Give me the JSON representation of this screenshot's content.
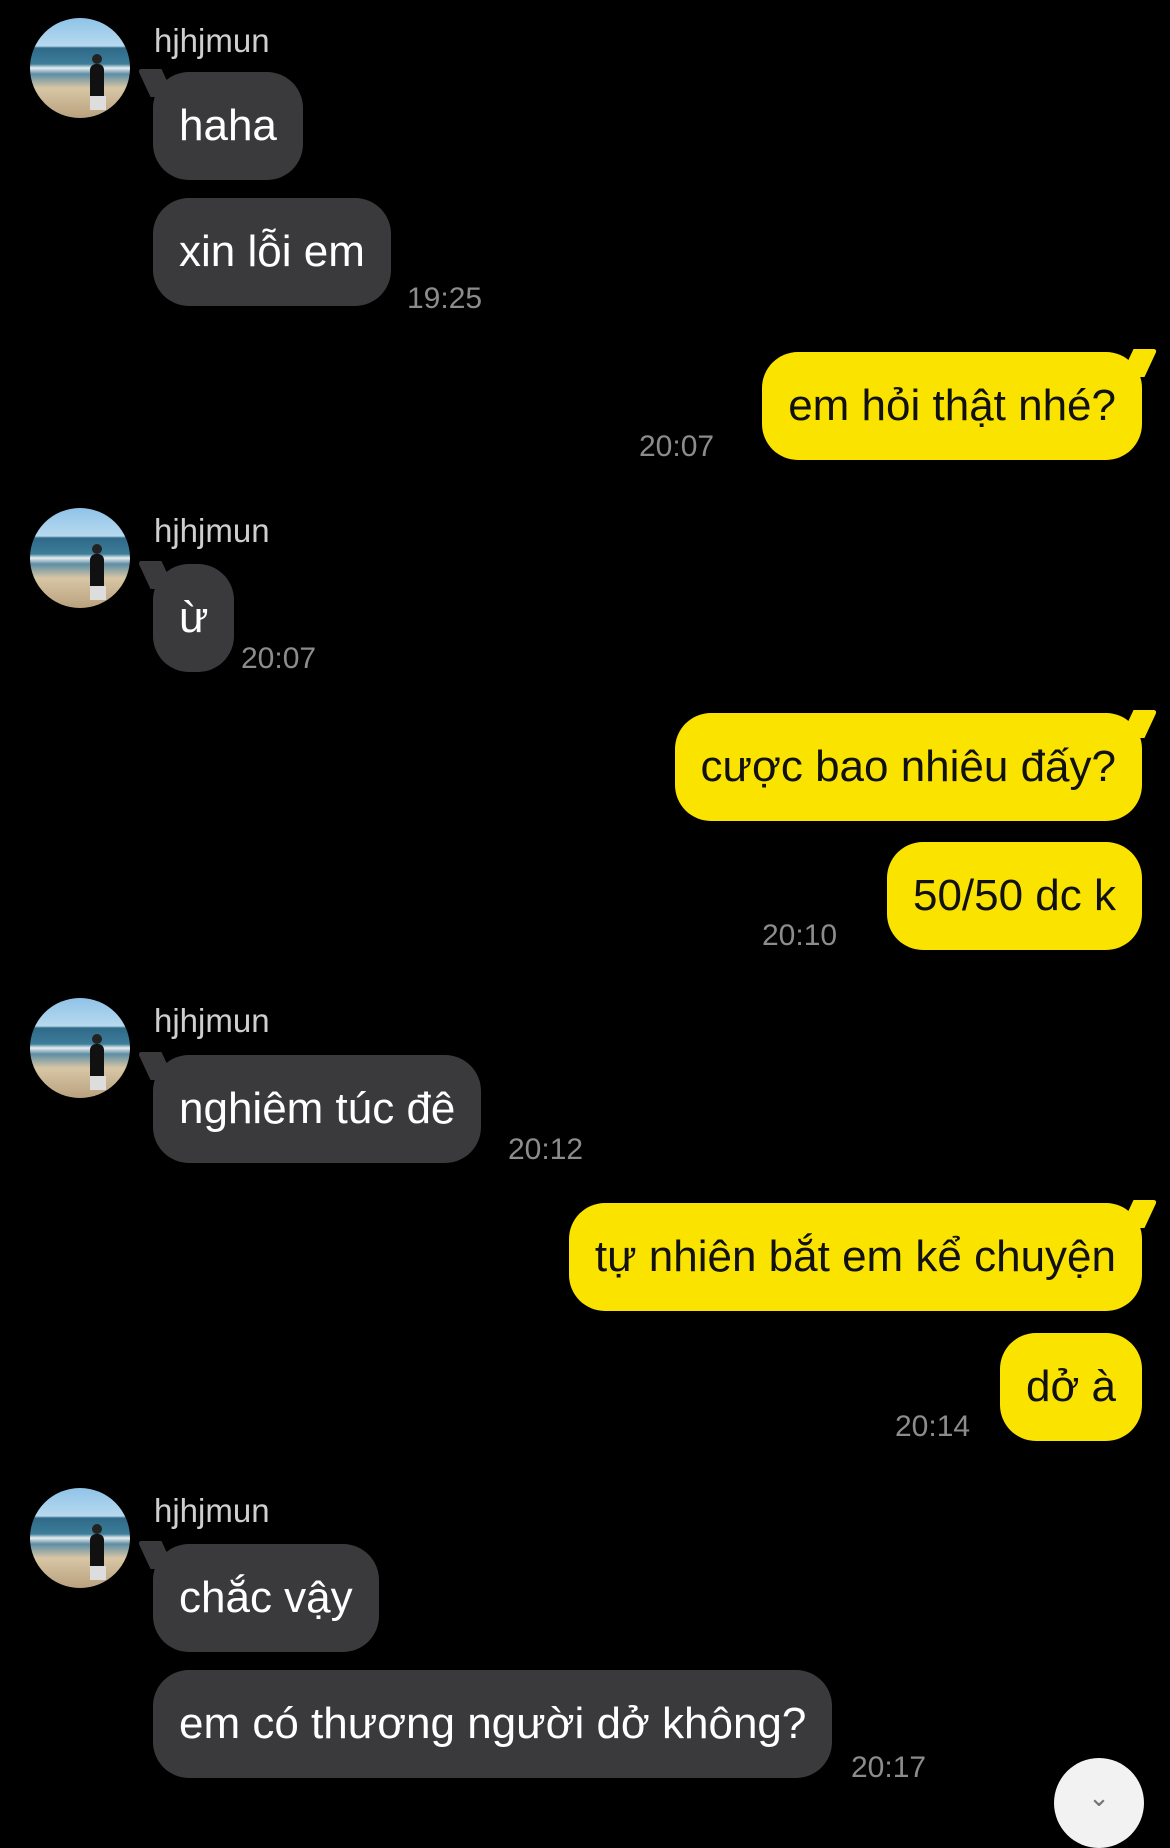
{
  "chat": {
    "messages": [
      {
        "sender": "hjhjmun",
        "text": "haha",
        "time": ""
      },
      {
        "sender": "hjhjmun",
        "text": "xin lỗi em",
        "time": "19:25"
      },
      {
        "sender": "me",
        "text": "em hỏi thật nhé?",
        "time": "20:07"
      },
      {
        "sender": "hjhjmun",
        "text": "ừ",
        "time": "20:07"
      },
      {
        "sender": "me",
        "text": "cược bao nhiêu đấy?",
        "time": ""
      },
      {
        "sender": "me",
        "text": "50/50 dc k",
        "time": "20:10"
      },
      {
        "sender": "hjhjmun",
        "text": "nghiêm túc đê",
        "time": "20:12"
      },
      {
        "sender": "me",
        "text": "tự nhiên bắt em kể chuyện",
        "time": ""
      },
      {
        "sender": "me",
        "text": "dở à",
        "time": "20:14"
      },
      {
        "sender": "hjhjmun",
        "text": "chắc vậy",
        "time": ""
      },
      {
        "sender": "hjhjmun",
        "text": "em có thương người dở không?",
        "time": "20:17"
      }
    ]
  },
  "icons": {
    "scroll_button": "chevron-down-icon"
  },
  "colors": {
    "background": "#000000",
    "incoming_bubble": "#3a3a3c",
    "outgoing_bubble": "#fbe300",
    "timestamp": "#8c8c8c"
  }
}
